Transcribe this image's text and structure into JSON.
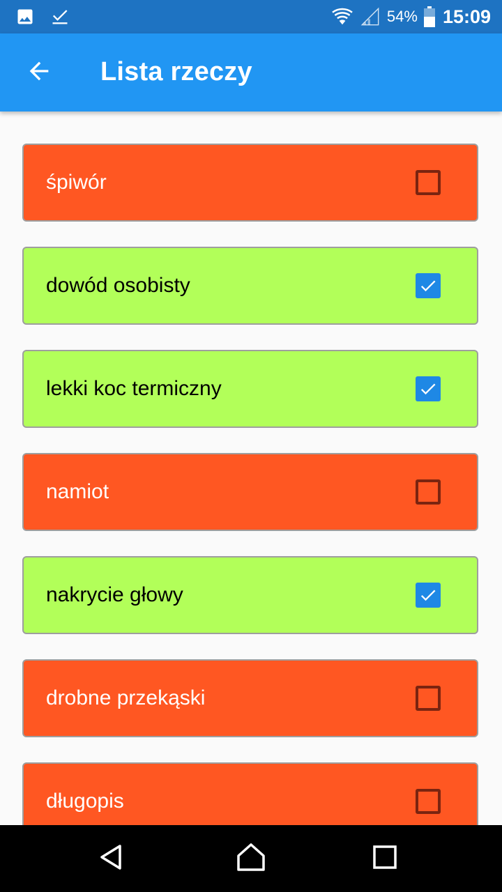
{
  "status_bar": {
    "notification_icons": [
      "image-icon",
      "download-done-icon"
    ],
    "battery_percent": "54%",
    "time": "15:09"
  },
  "app_bar": {
    "back_icon": "arrow-back-icon",
    "title": "Lista rzeczy"
  },
  "items": [
    {
      "label": "śpiwór",
      "checked": false
    },
    {
      "label": "dowód osobisty",
      "checked": true
    },
    {
      "label": "lekki koc termiczny",
      "checked": true
    },
    {
      "label": "namiot",
      "checked": false
    },
    {
      "label": "nakrycie głowy",
      "checked": true
    },
    {
      "label": "drobne przekąski",
      "checked": false
    },
    {
      "label": "długopis",
      "checked": false
    }
  ],
  "colors": {
    "unchecked_bg": "#ff5722",
    "checked_bg": "#b2ff59",
    "app_bar": "#2196f3",
    "status_bar": "#1e73c2",
    "checkbox_checked": "#1e88e5"
  },
  "nav_bar": {
    "icons": [
      "back-triangle-icon",
      "home-icon",
      "recents-icon"
    ]
  }
}
